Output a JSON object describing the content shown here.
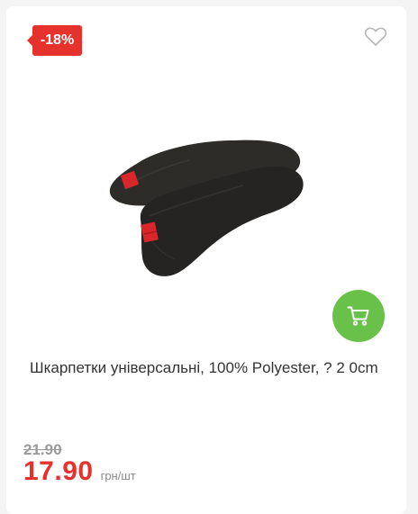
{
  "product": {
    "discount_badge": "-18%",
    "title": "Шкарпетки універсальні, 100% Polyester, ? 2 0cm",
    "old_price": "21.90",
    "price": "17.90",
    "unit": "грн/шт",
    "image_icon": "black-socks-image"
  },
  "icons": {
    "wishlist": "heart-outline-icon",
    "cart": "shopping-cart-icon"
  },
  "colors": {
    "discount": "#e5322d",
    "price": "#e5322d",
    "cart_button": "#6ac14a",
    "old_price": "#9a9a9a"
  }
}
